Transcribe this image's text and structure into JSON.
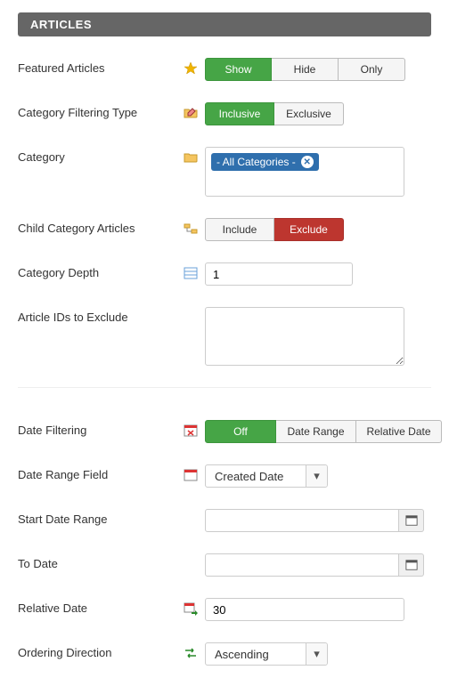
{
  "header": "ARTICLES",
  "labels": {
    "featured": "Featured Articles",
    "catFilterType": "Category Filtering Type",
    "category": "Category",
    "childCat": "Child Category Articles",
    "catDepth": "Category Depth",
    "excludeIds": "Article IDs to Exclude",
    "dateFiltering": "Date Filtering",
    "dateRangeField": "Date Range Field",
    "startDate": "Start Date Range",
    "toDate": "To Date",
    "relativeDate": "Relative Date",
    "orderDir": "Ordering Direction"
  },
  "buttons": {
    "show": "Show",
    "hide": "Hide",
    "only": "Only",
    "inclusive": "Inclusive",
    "exclusive": "Exclusive",
    "include": "Include",
    "exclude": "Exclude",
    "off": "Off",
    "dateRange": "Date Range",
    "relativeDate": "Relative Date"
  },
  "values": {
    "categoryTag": "- All Categories -",
    "categoryDepth": "1",
    "excludeIds": "",
    "dateRangeField": "Created Date",
    "startDate": "",
    "toDate": "",
    "relativeDate": "30",
    "orderingDirection": "Ascending"
  }
}
